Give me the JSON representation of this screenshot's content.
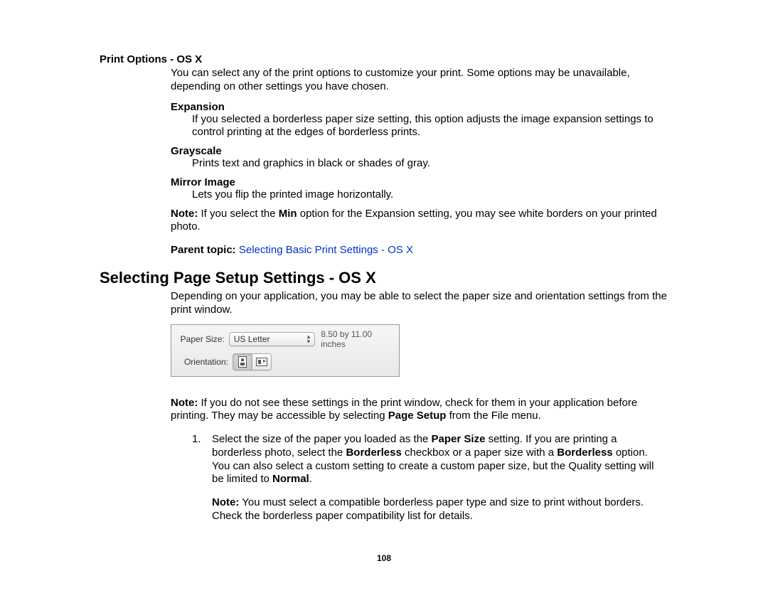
{
  "section1": {
    "title": "Print Options - OS X",
    "intro": "You can select any of the print options to customize your print. Some options may be unavailable, depending on other settings you have chosen.",
    "options": [
      {
        "name": "Expansion",
        "desc": "If you selected a borderless paper size setting, this option adjusts the image expansion settings to control printing at the edges of borderless prints."
      },
      {
        "name": "Grayscale",
        "desc": "Prints text and graphics in black or shades of gray."
      },
      {
        "name": "Mirror Image",
        "desc": "Lets you flip the printed image horizontally."
      }
    ],
    "note_label": "Note:",
    "note_pre": " If you select the ",
    "note_bold": "Min",
    "note_post": " option for the Expansion setting, you may see white borders on your printed photo.",
    "parent_label": "Parent topic:",
    "parent_link": "Selecting Basic Print Settings - OS X"
  },
  "section2": {
    "heading": "Selecting Page Setup Settings - OS X",
    "intro": "Depending on your application, you may be able to select the paper size and orientation settings from the print window.",
    "figure": {
      "paper_size_label": "Paper Size:",
      "paper_size_value": "US Letter",
      "dimensions": "8.50 by 11.00 inches",
      "orientation_label": "Orientation:"
    },
    "note2_label": "Note:",
    "note2_pre": " If you do not see these settings in the print window, check for them in your application before printing. They may be accessible by selecting ",
    "note2_bold": "Page Setup",
    "note2_post": " from the File menu.",
    "step1": {
      "num": "1.",
      "t1": "Select the size of the paper you loaded as the ",
      "b1": "Paper Size",
      "t2": " setting. If you are printing a borderless photo, select the ",
      "b2": "Borderless",
      "t3": " checkbox or a paper size with a ",
      "b3": "Borderless",
      "t4": " option. You can also select a custom setting to create a custom paper size, but the Quality setting will be limited to ",
      "b4": "Normal",
      "t5": "."
    },
    "step1_note_label": "Note:",
    "step1_note": " You must select a compatible borderless paper type and size to print without borders. Check the borderless paper compatibility list for details."
  },
  "page_number": "108"
}
